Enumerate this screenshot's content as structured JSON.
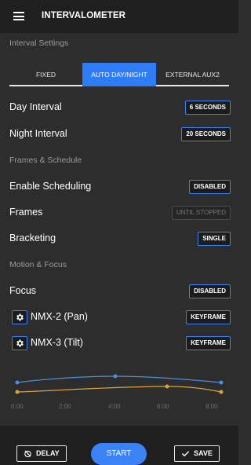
{
  "app": {
    "title": "INTERVALOMETER"
  },
  "sections": {
    "interval_settings": "Interval Settings",
    "frames_schedule": "Frames & Schedule",
    "motion_focus": "Motion & Focus"
  },
  "tabs": [
    {
      "label": "FIXED",
      "active": false
    },
    {
      "label": "AUTO DAY/NIGHT",
      "active": true
    },
    {
      "label": "EXTERNAL AUX2",
      "active": false
    }
  ],
  "rows": {
    "day_interval": {
      "label": "Day Interval",
      "value": "6 SECONDS"
    },
    "night_interval": {
      "label": "Night Interval",
      "value": "20 SECONDS"
    },
    "enable_scheduling": {
      "label": "Enable Scheduling",
      "value": "DISABLED"
    },
    "frames": {
      "label": "Frames",
      "value": "UNTIL STOPPED"
    },
    "bracketing": {
      "label": "Bracketing",
      "value": "SINGLE"
    },
    "focus": {
      "label": "Focus",
      "value": "DISABLED"
    },
    "nmx2": {
      "label": "NMX-2 (Pan)",
      "value": "KEYFRAME"
    },
    "nmx3": {
      "label": "NMX-3 (Tilt)",
      "value": "KEYFRAME"
    }
  },
  "keyframe_chart": {
    "tick_labels": [
      "0:00",
      "2:00",
      "4:00",
      "6:00",
      "8:00"
    ],
    "series": [
      {
        "color": "#4d8fd9",
        "values": [
          0.6,
          1.0,
          0.6
        ]
      },
      {
        "color": "#d9a441",
        "values": [
          0.0,
          0.5,
          0.0
        ]
      }
    ]
  },
  "bottom": {
    "delay_label": "DELAY",
    "start_label": "START",
    "save_label": "SAVE"
  },
  "colors": {
    "accent": "#3b82f6",
    "background": "#2d2d2d",
    "bar": "#1f1f1f"
  }
}
